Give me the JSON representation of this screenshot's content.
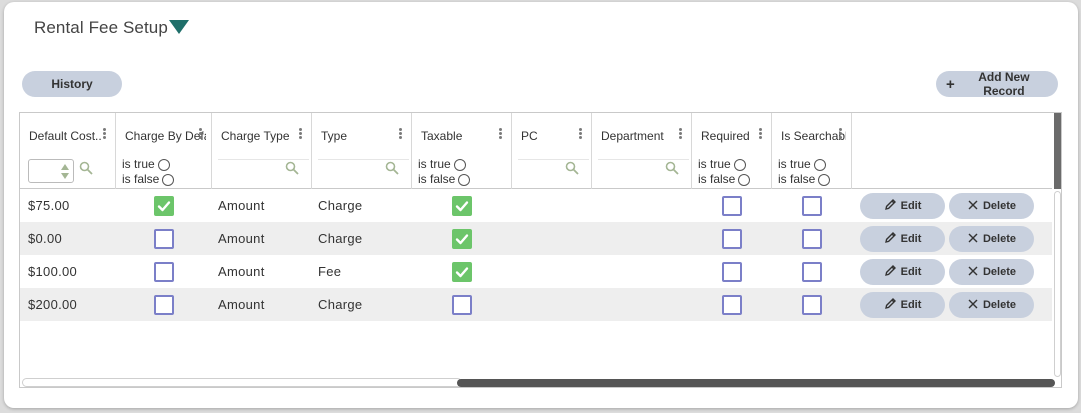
{
  "page": {
    "title": "Rental Fee Setup",
    "history_label": "History",
    "add_label": "Add New Record",
    "add_icon": "plus-icon",
    "title_icon": "caret-down-icon",
    "accent_color": "#1f6f6a",
    "button_color": "#c8d0de",
    "check_color": "#6cc56a",
    "checkbox_border_color": "#7b7fc8"
  },
  "columns": [
    {
      "label": "Default Cost..",
      "filter": "number"
    },
    {
      "label": "Charge By Default",
      "filter": "bool"
    },
    {
      "label": "Charge Type",
      "filter": "search"
    },
    {
      "label": "Type",
      "filter": "search"
    },
    {
      "label": "Taxable",
      "filter": "bool"
    },
    {
      "label": "PC",
      "filter": "search"
    },
    {
      "label": "Department",
      "filter": "search"
    },
    {
      "label": "Required",
      "filter": "bool"
    },
    {
      "label": "Is Searchable",
      "filter": "bool"
    }
  ],
  "bool_filter": {
    "true_label": "is true",
    "false_label": "is false"
  },
  "row_actions": {
    "edit_label": "Edit",
    "delete_label": "Delete"
  },
  "rows": [
    {
      "default_cost": "$75.00",
      "charge_by_default": true,
      "charge_type": "Amount",
      "type": "Charge",
      "taxable": true,
      "pc": "",
      "department": "",
      "required": false,
      "is_searchable": false
    },
    {
      "default_cost": "$0.00",
      "charge_by_default": false,
      "charge_type": "Amount",
      "type": "Charge",
      "taxable": true,
      "pc": "",
      "department": "",
      "required": false,
      "is_searchable": false
    },
    {
      "default_cost": "$100.00",
      "charge_by_default": false,
      "charge_type": "Amount",
      "type": "Fee",
      "taxable": true,
      "pc": "",
      "department": "",
      "required": false,
      "is_searchable": false
    },
    {
      "default_cost": "$200.00",
      "charge_by_default": false,
      "charge_type": "Amount",
      "type": "Charge",
      "taxable": false,
      "pc": "",
      "department": "",
      "required": false,
      "is_searchable": false
    }
  ]
}
